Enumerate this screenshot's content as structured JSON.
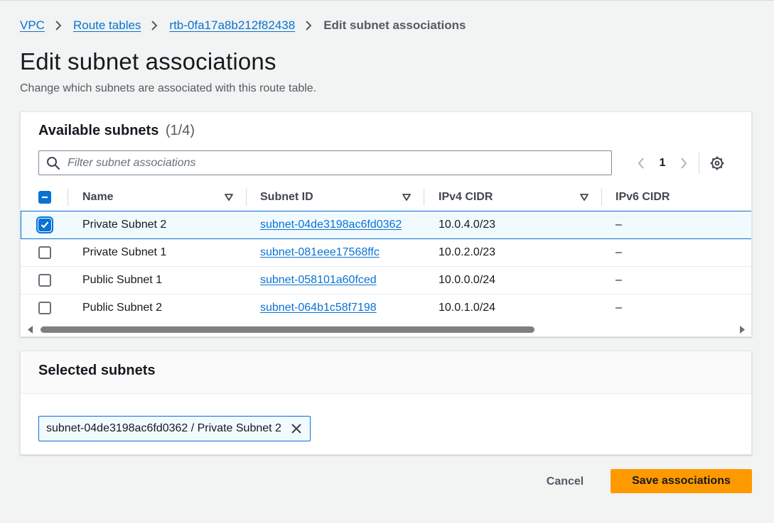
{
  "breadcrumb": {
    "items": [
      "VPC",
      "Route tables",
      "rtb-0fa17a8b212f82438"
    ],
    "current": "Edit subnet associations"
  },
  "page": {
    "title": "Edit subnet associations",
    "description": "Change which subnets are associated with this route table."
  },
  "available": {
    "title": "Available subnets",
    "count": "(1/4)",
    "filter_placeholder": "Filter subnet associations",
    "page_number": "1",
    "columns": [
      "Name",
      "Subnet ID",
      "IPv4 CIDR",
      "IPv6 CIDR"
    ],
    "rows": [
      {
        "name": "Private Subnet 2",
        "subnet_id": "subnet-04de3198ac6fd0362",
        "ipv4": "10.0.4.0/23",
        "ipv6": "–",
        "checked": true
      },
      {
        "name": "Private Subnet 1",
        "subnet_id": "subnet-081eee17568ffc",
        "ipv4": "10.0.2.0/23",
        "ipv6": "–",
        "checked": false
      },
      {
        "name": "Public Subnet 1",
        "subnet_id": "subnet-058101a60fced",
        "ipv4": "10.0.0.0/24",
        "ipv6": "–",
        "checked": false
      },
      {
        "name": "Public Subnet 2",
        "subnet_id": "subnet-064b1c58f7198",
        "ipv4": "10.0.1.0/24",
        "ipv6": "–",
        "checked": false
      }
    ]
  },
  "selected": {
    "title": "Selected subnets",
    "tokens": [
      "subnet-04de3198ac6fd0362 / Private Subnet 2"
    ]
  },
  "actions": {
    "cancel": "Cancel",
    "save": "Save associations"
  },
  "colors": {
    "link": "#0972d3",
    "primary_button": "#ff9900",
    "selected_row_bg": "#f1faff"
  }
}
